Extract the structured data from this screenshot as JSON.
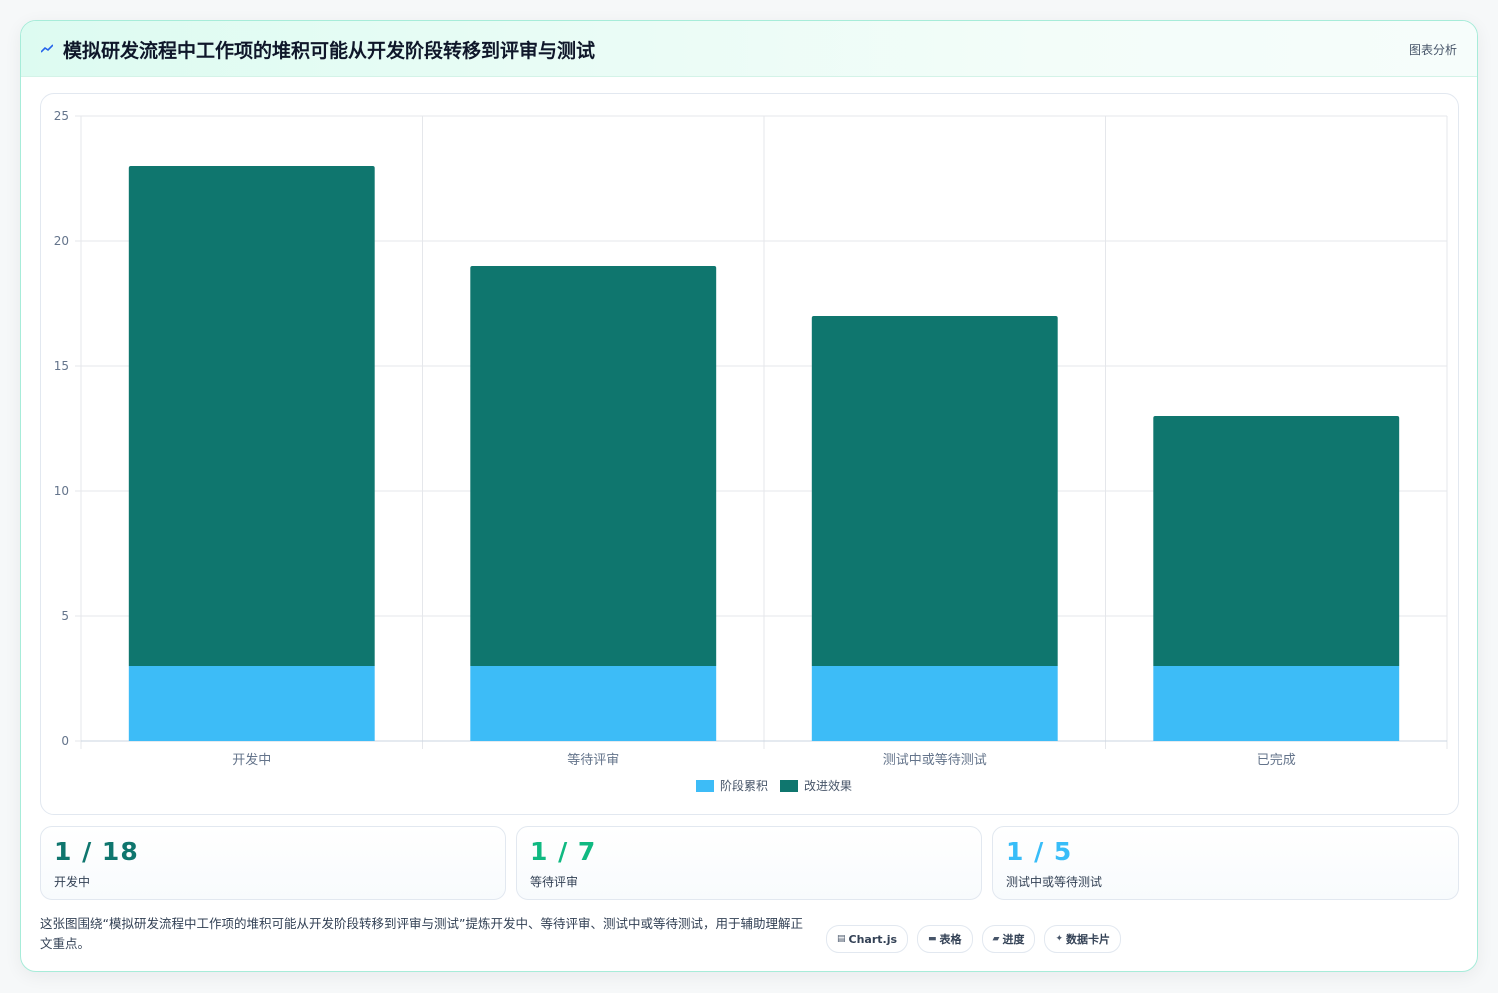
{
  "header": {
    "title": "模拟研发流程中工作项的堆积可能从开发阶段转移到评审与测试",
    "right_label": "图表分析",
    "icon": "trend-line-icon"
  },
  "chart_data": {
    "type": "bar",
    "stacked": true,
    "categories": [
      "开发中",
      "等待评审",
      "测试中或等待测试",
      "已完成"
    ],
    "series": [
      {
        "name": "阶段累积",
        "values": [
          3,
          3,
          3,
          3
        ],
        "color": "#3dbcf7"
      },
      {
        "name": "改进效果",
        "values": [
          20,
          16,
          14,
          10
        ],
        "color": "#0f766e"
      }
    ],
    "ylim": [
      0,
      25
    ],
    "yticks": [
      0,
      5,
      10,
      15,
      20,
      25
    ],
    "grid": true,
    "legend": "bottom"
  },
  "stats": [
    {
      "value": "1 / 18",
      "label": "开发中",
      "color": "#0f766e"
    },
    {
      "value": "1 / 7",
      "label": "等待评审",
      "color": "#10b981"
    },
    {
      "value": "1 / 5",
      "label": "测试中或等待测试",
      "color": "#38bdf8"
    }
  ],
  "footer": {
    "text": "这张图围绕“模拟研发流程中工作项的堆积可能从开发阶段转移到评审与测试”提炼开发中、等待评审、测试中或等待测试，用于辅助理解正文重点。",
    "chips": [
      {
        "icon": "▤",
        "icon_name": "chart-icon",
        "label": "Chart.js"
      },
      {
        "icon": "▬",
        "icon_name": "table-icon",
        "label": "表格"
      },
      {
        "icon": "▰",
        "icon_name": "progress-icon",
        "label": "进度"
      },
      {
        "icon": "✦",
        "icon_name": "sparkle-icon",
        "label": "数据卡片"
      }
    ]
  }
}
